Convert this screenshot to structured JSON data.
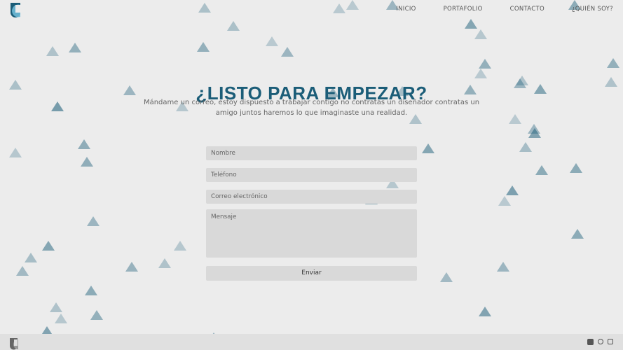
{
  "brand": {
    "logo_name": "jc-logo",
    "accent": "#1b5d78",
    "accent_light": "#6fb9d5"
  },
  "nav": {
    "items": [
      {
        "label": "INICIO"
      },
      {
        "label": "PORTAFOLIO"
      },
      {
        "label": "CONTACTO"
      },
      {
        "label": "¿QUIÉN SOY?"
      }
    ]
  },
  "hero": {
    "title": "¿LISTO PARA EMPEZAR?",
    "subtitle": "Mándame un correo, estoy dispuesto a trabajar contigo no contratas un diseñador contratas un amigo juntos haremos lo que imaginaste una realidad."
  },
  "form": {
    "name_placeholder": "Nombre",
    "phone_placeholder": "Teléfono",
    "email_placeholder": "Correo electrónico",
    "message_placeholder": "Mensaje",
    "submit_label": "Enviar"
  },
  "footer": {
    "social_icons": [
      "facebook-icon",
      "whatsapp-icon",
      "instagram-icon"
    ]
  }
}
